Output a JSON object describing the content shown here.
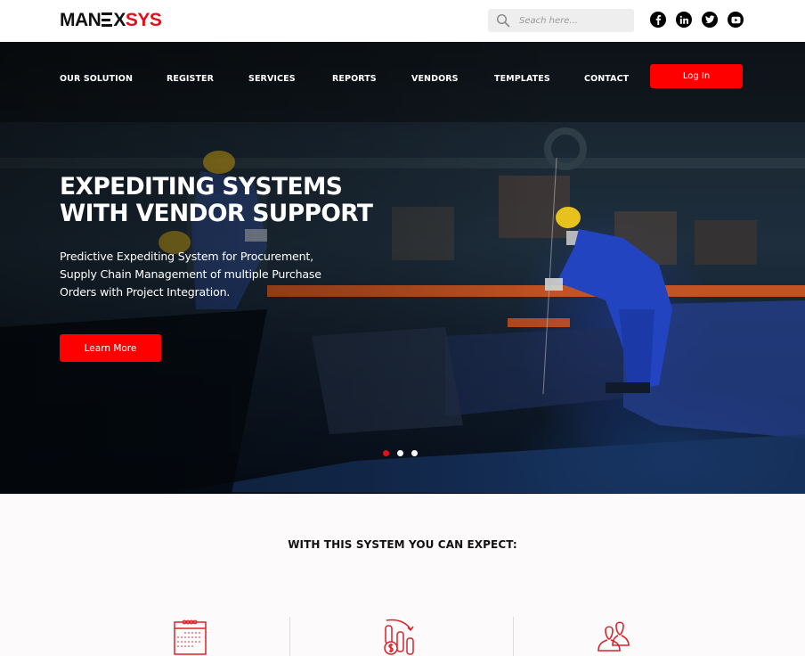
{
  "brand": {
    "logo_left": "MAN",
    "logo_mid": "X",
    "logo_right": "SYS",
    "accent_color": "#e3101a",
    "button_color": "#ff0000"
  },
  "search": {
    "placeholder": "Seach here...",
    "value": ""
  },
  "social": [
    {
      "name": "facebook-icon"
    },
    {
      "name": "linkedin-icon"
    },
    {
      "name": "twitter-icon"
    },
    {
      "name": "youtube-icon"
    }
  ],
  "nav": {
    "items": [
      {
        "label": "OUR SOLUTION"
      },
      {
        "label": "REGISTER"
      },
      {
        "label": "SERVICES"
      },
      {
        "label": "REPORTS"
      },
      {
        "label": "VENDORS"
      },
      {
        "label": "TEMPLATES"
      },
      {
        "label": "CONTACT"
      }
    ],
    "login_label": "Log In"
  },
  "hero": {
    "headline_line1": "EXPEDITING SYSTEMS",
    "headline_line2": "WITH VENDOR SUPPORT",
    "subtext": "Predictive Expediting System for Procurement, Supply Chain Management of multiple Purchase Orders with Project Integration.",
    "cta_label": "Learn More",
    "slides_total": 3,
    "active_slide": 1
  },
  "features": {
    "title": "WITH THIS SYSTEM YOU CAN EXPECT:",
    "icons": [
      "calendar-icon",
      "cost-reduction-icon",
      "users-icon"
    ]
  }
}
